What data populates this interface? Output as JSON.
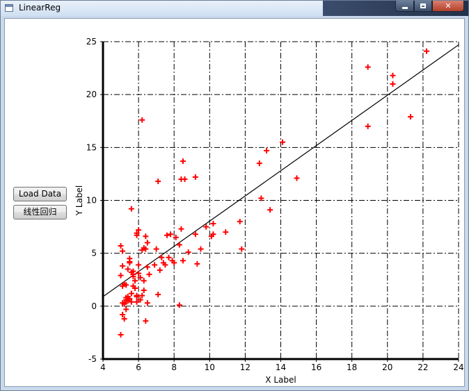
{
  "window": {
    "title": "LinearReg"
  },
  "titlebar_controls": {
    "close_label": "✕"
  },
  "buttons": {
    "load_data": "Load Data",
    "linear_regression": "线性回归"
  },
  "chart_data": {
    "type": "scatter",
    "title": "",
    "xlabel": "X Label",
    "ylabel": "Y Label",
    "xlim": [
      4,
      24
    ],
    "ylim": [
      -5,
      25
    ],
    "xticks": [
      4,
      6,
      8,
      10,
      12,
      14,
      16,
      18,
      20,
      22,
      24
    ],
    "yticks": [
      -5,
      0,
      5,
      10,
      15,
      20,
      25
    ],
    "grid": true,
    "grid_style": "dash-dot",
    "marker": "+",
    "marker_color": "#ff0000",
    "line_color": "#000000",
    "series": [
      {
        "type": "scatter",
        "x": [
          5.0,
          5.1,
          5.1,
          5.2,
          5.2,
          5.3,
          5.1,
          5.2,
          5.3,
          5.4,
          5.4,
          5.5,
          5.5,
          5.6,
          5.6,
          5.7,
          5.7,
          5.8,
          5.8,
          5.9,
          5.9,
          6.0,
          5.9,
          6.0,
          6.1,
          6.2,
          6.3,
          6.3,
          6.4,
          6.4,
          6.5,
          6.5,
          5.3,
          5.5,
          5.6,
          5.7,
          5.8,
          5.9,
          6.0,
          6.1,
          6.2,
          6.3,
          6.4,
          6.5,
          6.6,
          5.0,
          5.1,
          5.2,
          5.3,
          5.6,
          5.5,
          5.4,
          5.7,
          5.0,
          5.1,
          5.9,
          6.9,
          7.0,
          7.1,
          7.2,
          7.3,
          7.4,
          7.5,
          7.6,
          7.7,
          7.8,
          7.9,
          8.0,
          8.1,
          8.3,
          8.4,
          8.5,
          8.8,
          9.2,
          9.3,
          9.5,
          9.8,
          10.1,
          10.2,
          10.2,
          10.9,
          11.7,
          11.8,
          7.1,
          8.4,
          8.5,
          8.6,
          9.2,
          12.8,
          12.9,
          13.2,
          13.4,
          14.1,
          14.9,
          6.2,
          18.9,
          18.9,
          20.3,
          20.3,
          21.3,
          22.2,
          8.3
        ],
        "y": [
          5.7,
          5.2,
          3.8,
          2.1,
          0.3,
          0.6,
          -0.8,
          -1.2,
          2.0,
          0.9,
          3.5,
          4.1,
          4.5,
          0.4,
          3.2,
          2.8,
          1.9,
          1.7,
          2.4,
          6.9,
          1.0,
          7.2,
          0.4,
          3.1,
          2.7,
          5.3,
          5.5,
          1.5,
          6.6,
          5.4,
          6.0,
          0.3,
          -0.3,
          0.7,
          1.2,
          3.3,
          1.7,
          0.9,
          3.9,
          0.6,
          1.0,
          2.4,
          -1.4,
          3.7,
          3.0,
          -2.7,
          0.3,
          0.2,
          0.8,
          9.2,
          4.2,
          0.5,
          3.0,
          2.9,
          1.9,
          6.7,
          3.9,
          5.4,
          1.1,
          3.4,
          4.6,
          4.1,
          3.9,
          6.7,
          4.6,
          6.8,
          4.3,
          4.1,
          6.5,
          5.8,
          7.3,
          4.3,
          5.1,
          6.8,
          4.0,
          5.4,
          7.5,
          6.6,
          7.8,
          6.8,
          7.0,
          8.0,
          5.4,
          11.8,
          12.0,
          13.7,
          12.0,
          12.2,
          13.5,
          10.2,
          14.7,
          9.1,
          15.5,
          12.1,
          17.6,
          22.6,
          17.0,
          21.8,
          21.0,
          17.9,
          24.1,
          0.1
        ]
      },
      {
        "type": "line",
        "x": [
          4,
          24
        ],
        "y": [
          0.9,
          24.7
        ]
      }
    ]
  }
}
